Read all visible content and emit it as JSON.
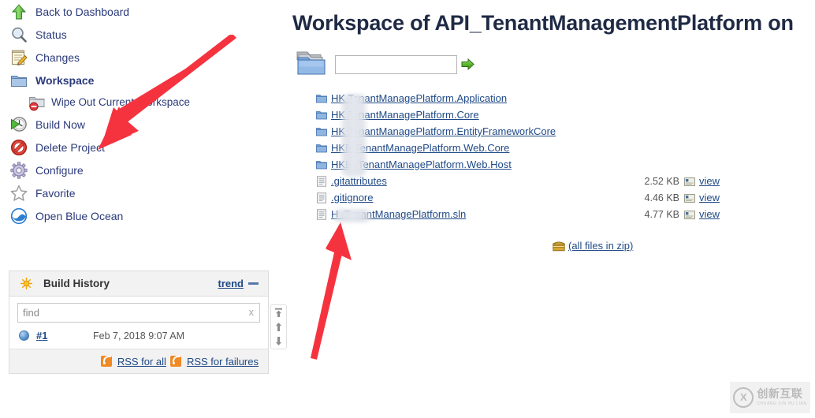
{
  "sidebar": {
    "tasks": [
      {
        "label": "Back to Dashboard",
        "icon": "up-arrow-icon",
        "bold": false,
        "sub": false
      },
      {
        "label": "Status",
        "icon": "magnifier-icon",
        "bold": false,
        "sub": false
      },
      {
        "label": "Changes",
        "icon": "notepad-pencil-icon",
        "bold": false,
        "sub": false
      },
      {
        "label": "Workspace",
        "icon": "folder-icon",
        "bold": true,
        "sub": false
      },
      {
        "label": "Wipe Out Current Workspace",
        "icon": "folder-delete-icon",
        "bold": false,
        "sub": true
      },
      {
        "label": "Build Now",
        "icon": "clock-play-icon",
        "bold": false,
        "sub": false
      },
      {
        "label": "Delete Project",
        "icon": "no-entry-icon",
        "bold": false,
        "sub": false
      },
      {
        "label": "Configure",
        "icon": "gear-icon",
        "bold": false,
        "sub": false
      },
      {
        "label": "Favorite",
        "icon": "star-icon",
        "bold": false,
        "sub": false
      },
      {
        "label": "Open Blue Ocean",
        "icon": "blue-ocean-icon",
        "bold": false,
        "sub": false
      }
    ]
  },
  "build_history": {
    "title": "Build History",
    "icon": "sun-icon",
    "trend_label": "trend",
    "collapse_icon": "minus-icon",
    "find_placeholder": "find",
    "find_value": "",
    "clear_label": "x",
    "builds": [
      {
        "number": "#1",
        "date": "Feb 7, 2018 9:07 AM",
        "status_icon": "blue-ball-icon"
      }
    ],
    "rss_all_label": "RSS for all",
    "rss_failures_label": "RSS for failures",
    "scroll_buttons": [
      "scroll-to-top-icon",
      "scroll-up-icon",
      "scroll-down-icon"
    ]
  },
  "main": {
    "title": "Workspace of API_TenantManagementPlatform on",
    "path_input_value": "",
    "path_input_placeholder": "",
    "go_icon": "green-arrow-icon",
    "folder_icon": "big-folder-icon",
    "files": [
      {
        "name": "HK         TenantManagePlatform.Application",
        "type": "folder",
        "size": "",
        "view": "",
        "redacted": true
      },
      {
        "name": "HK         TenantManagePlatform.Core",
        "type": "folder",
        "size": "",
        "view": "",
        "redacted": true
      },
      {
        "name": "HK         TenantManagePlatform.EntityFrameworkCore",
        "type": "folder",
        "size": "",
        "view": "",
        "redacted": true
      },
      {
        "name": "HKB       TenantManagePlatform.Web.Core",
        "type": "folder",
        "size": "",
        "view": "",
        "redacted": true
      },
      {
        "name": "HKB     .TenantManagePlatform.Web.Host",
        "type": "folder",
        "size": "",
        "view": "",
        "redacted": true
      },
      {
        "name": ".gitattributes",
        "type": "file",
        "size": "2.52 KB",
        "view": "view",
        "redacted": false
      },
      {
        "name": ".gitignore",
        "type": "file",
        "size": "4.46 KB",
        "view": "view",
        "redacted": false
      },
      {
        "name": "H          .TenantManagePlatform.sln",
        "type": "file",
        "size": "4.77 KB",
        "view": "view",
        "redacted": true
      }
    ],
    "zip_label": "(all files in zip)",
    "zip_icon": "zip-box-icon"
  },
  "annotations": [
    {
      "name": "arrow-to-build-now",
      "color": "#f5333f"
    },
    {
      "name": "arrow-to-sln-file",
      "color": "#f5333f"
    }
  ],
  "watermark": {
    "chinese": "创新互联",
    "pinyin": "CHUANG XIN HU LIAN",
    "mark": "cx-logo-icon"
  }
}
